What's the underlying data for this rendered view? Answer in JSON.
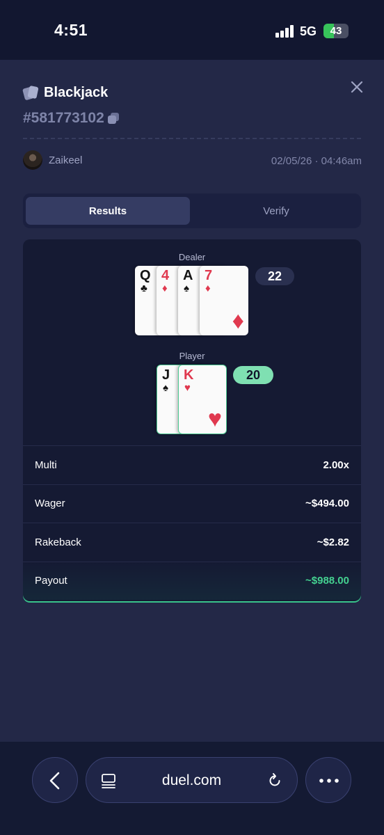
{
  "status_bar": {
    "time": "4:51",
    "network": "5G",
    "battery": "43"
  },
  "modal": {
    "title": "Blackjack",
    "game_id": "#581773102",
    "username": "Zaikeel",
    "datetime": "02/05/26 · 04:46am",
    "tabs": [
      {
        "label": "Results",
        "active": true
      },
      {
        "label": "Verify",
        "active": false
      }
    ]
  },
  "dealer": {
    "label": "Dealer",
    "score": "22",
    "cards": [
      {
        "rank": "Q",
        "suit": "♣",
        "color": "black"
      },
      {
        "rank": "4",
        "suit": "♦",
        "color": "red"
      },
      {
        "rank": "A",
        "suit": "♠",
        "color": "black"
      },
      {
        "rank": "7",
        "suit": "♦",
        "color": "red"
      }
    ]
  },
  "player": {
    "label": "Player",
    "score": "20",
    "cards": [
      {
        "rank": "J",
        "suit": "♠",
        "color": "black"
      },
      {
        "rank": "K",
        "suit": "♥",
        "color": "red"
      }
    ]
  },
  "summary": [
    {
      "label": "Multi",
      "value": "2.00x"
    },
    {
      "label": "Wager",
      "value": "~$494.00"
    },
    {
      "label": "Rakeback",
      "value": "~$2.82"
    },
    {
      "label": "Payout",
      "value": "~$988.00"
    }
  ],
  "colors": {
    "accent_green": "#44d190",
    "panel": "#232847",
    "background": "#151a33",
    "card_red": "#e0394f"
  },
  "browser": {
    "url": "duel.com"
  }
}
